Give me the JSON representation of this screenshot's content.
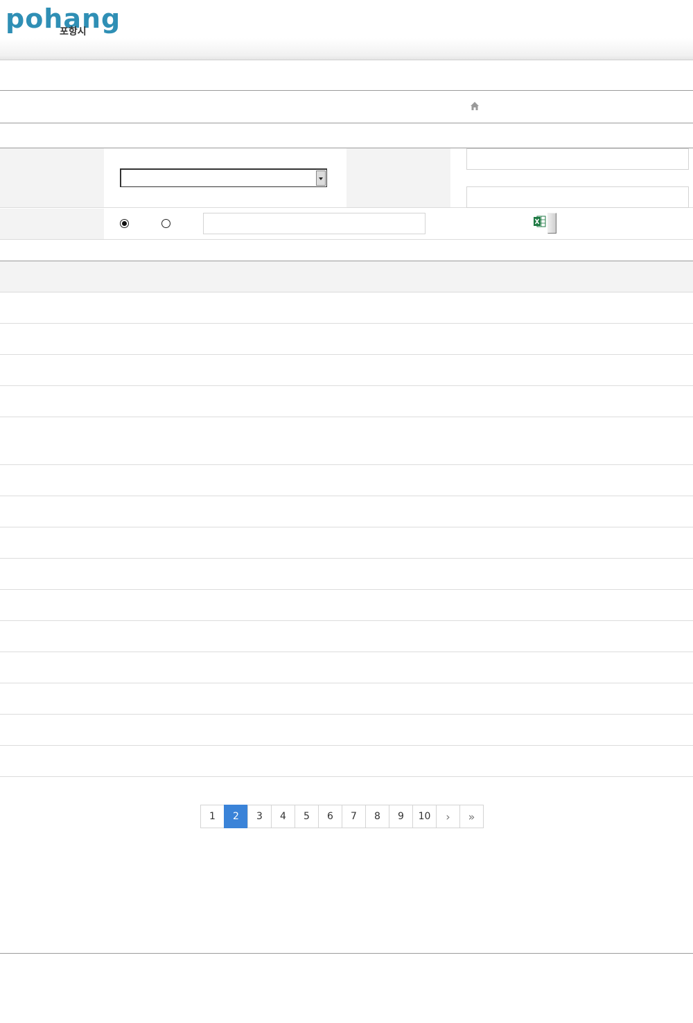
{
  "header": {
    "logo_word": "pohang",
    "logo_sub": "포항시"
  },
  "pagination": {
    "pages": [
      "1",
      "2",
      "3",
      "4",
      "5",
      "6",
      "7",
      "8",
      "9",
      "10"
    ],
    "current": "2",
    "next_label": "›",
    "last_label": "»"
  },
  "icons": {
    "home": "home-icon",
    "excel": "excel-icon"
  },
  "colors": {
    "accent": "#3a83d8",
    "logo": "#2f8fb5",
    "excel": "#1f7a44"
  }
}
